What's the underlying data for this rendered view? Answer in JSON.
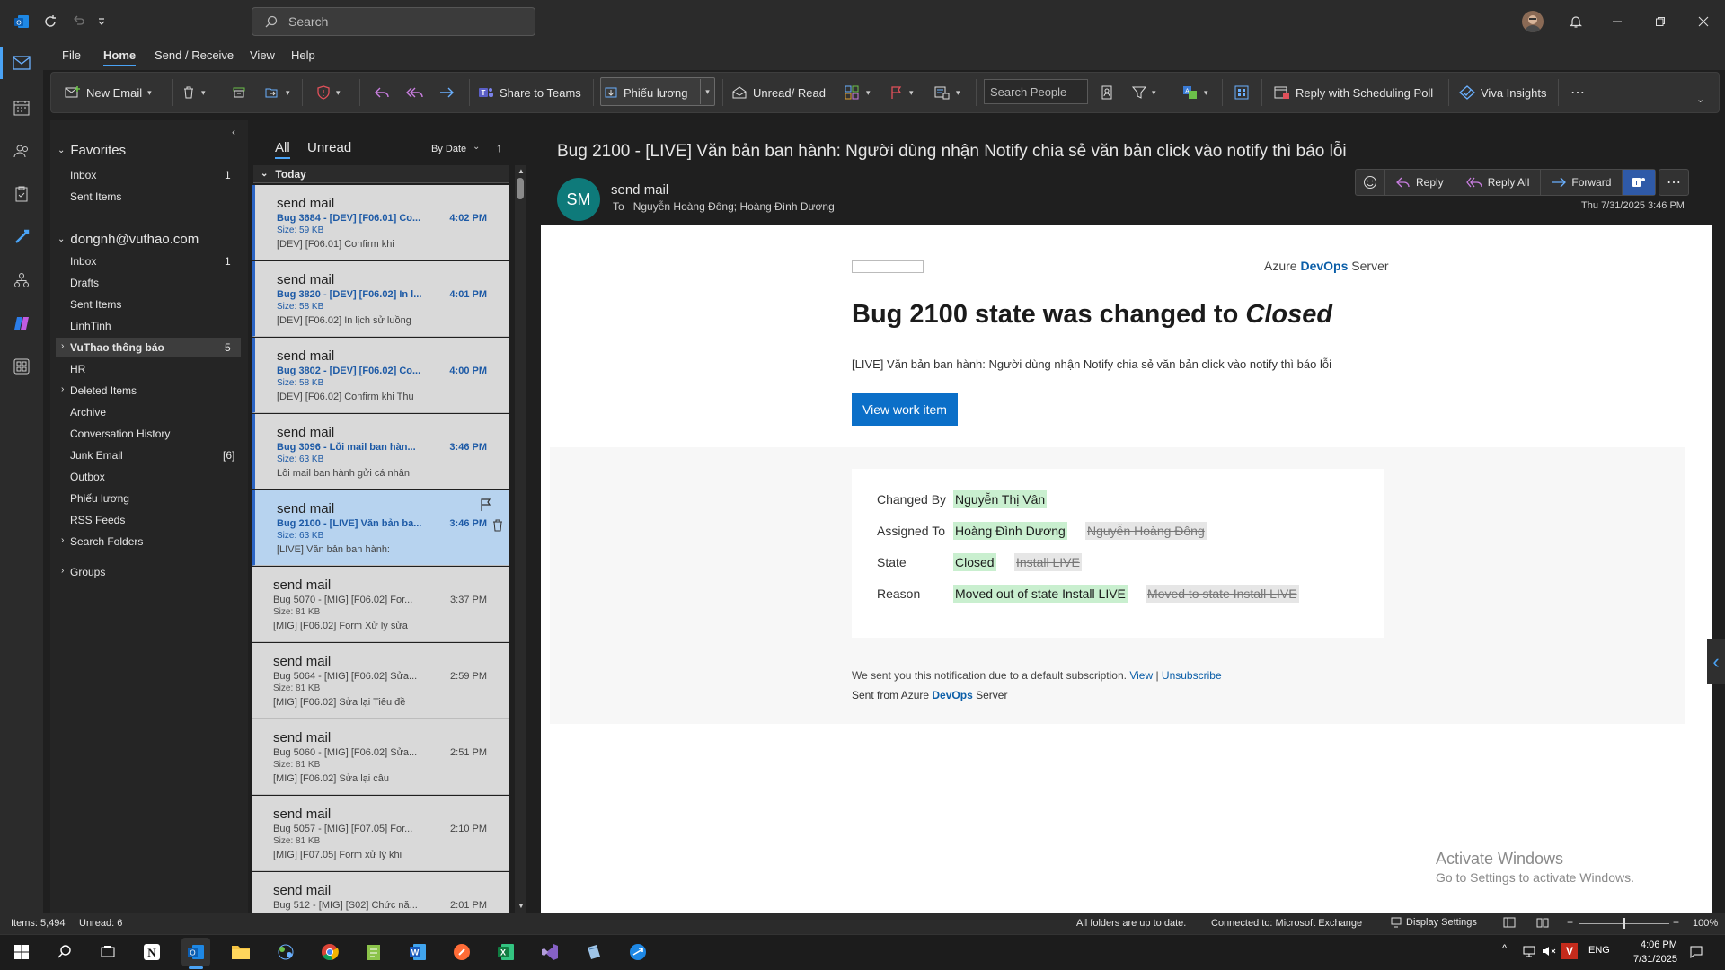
{
  "titlebar": {
    "search_placeholder": "Search"
  },
  "menu": [
    "File",
    "Home",
    "Send / Receive",
    "View",
    "Help"
  ],
  "ribbon": {
    "new_email": "New Email",
    "share_teams": "Share to Teams",
    "phieu_luong": "Phiếu lương",
    "unread_read": "Unread/ Read",
    "search_people": "Search People",
    "reply_poll": "Reply with Scheduling Poll",
    "viva": "Viva Insights"
  },
  "folders": {
    "favorites_header": "Favorites",
    "favorites": [
      {
        "label": "Inbox",
        "count": "1"
      },
      {
        "label": "Sent Items",
        "count": ""
      }
    ],
    "account": "dongnh@vuthao.com",
    "items": [
      {
        "label": "Inbox",
        "count": "1"
      },
      {
        "label": "Drafts",
        "count": ""
      },
      {
        "label": "Sent Items",
        "count": ""
      },
      {
        "label": "LinhTinh",
        "count": ""
      },
      {
        "label": "VuThao thông báo",
        "count": "5"
      },
      {
        "label": "HR",
        "count": ""
      },
      {
        "label": "Deleted Items",
        "count": ""
      },
      {
        "label": "Archive",
        "count": ""
      },
      {
        "label": "Conversation History",
        "count": ""
      },
      {
        "label": "Junk Email",
        "count": "[6]"
      },
      {
        "label": "Outbox",
        "count": ""
      },
      {
        "label": "Phiếu lương",
        "count": ""
      },
      {
        "label": "RSS Feeds",
        "count": ""
      },
      {
        "label": "Search Folders",
        "count": ""
      }
    ],
    "groups": "Groups"
  },
  "list": {
    "tab_all": "All",
    "tab_unread": "Unread",
    "sort": "By Date",
    "group_today": "Today",
    "messages": [
      {
        "sender": "send mail",
        "subject": "Bug 3684 - [DEV] [F06.01] Co...",
        "time": "4:02 PM",
        "size": "Size: 59 KB",
        "preview": "[DEV] [F06.01] Confirm khi"
      },
      {
        "sender": "send mail",
        "subject": "Bug 3820 - [DEV] [F06.02] In l...",
        "time": "4:01 PM",
        "size": "Size: 58 KB",
        "preview": "[DEV] [F06.02] In lịch sử luồng"
      },
      {
        "sender": "send mail",
        "subject": "Bug 3802 - [DEV] [F06.02] Co...",
        "time": "4:00 PM",
        "size": "Size: 58 KB",
        "preview": "[DEV] [F06.02] Confirm khi Thu"
      },
      {
        "sender": "send mail",
        "subject": "Bug 3096 - Lỗi mail ban hàn...",
        "time": "3:46 PM",
        "size": "Size: 63 KB",
        "preview": "Lỗi mail ban hành gửi cá nhân"
      },
      {
        "sender": "send mail",
        "subject": "Bug 2100 - [LIVE] Văn bản ba...",
        "time": "3:46 PM",
        "size": "Size: 63 KB",
        "preview": "[LIVE] Văn bản ban hành:"
      },
      {
        "sender": "send mail",
        "subject": "Bug 5070 - [MIG] [F06.02] For...",
        "time": "3:37 PM",
        "size": "Size: 81 KB",
        "preview": "[MIG] [F06.02] Form Xử lý sửa"
      },
      {
        "sender": "send mail",
        "subject": "Bug 5064 - [MIG] [F06.02] Sửa...",
        "time": "2:59 PM",
        "size": "Size: 81 KB",
        "preview": "[MIG] [F06.02] Sửa lại Tiêu đề"
      },
      {
        "sender": "send mail",
        "subject": "Bug 5060 - [MIG] [F06.02] Sửa...",
        "time": "2:51 PM",
        "size": "Size: 81 KB",
        "preview": "[MIG] [F06.02] Sửa lại câu"
      },
      {
        "sender": "send mail",
        "subject": "Bug 5057 - [MIG] [F07.05] For...",
        "time": "2:10 PM",
        "size": "Size: 81 KB",
        "preview": "[MIG] [F07.05] Form xử lý khi"
      },
      {
        "sender": "send mail",
        "subject": "Bug 512 - [MIG] [S02] Chức nă...",
        "time": "2:01 PM",
        "size": "",
        "preview": ""
      }
    ]
  },
  "reading": {
    "subject": "Bug 2100 - [LIVE] Văn bản ban hành: Người dùng nhận Notify chia sẻ văn bản click vào notify thì báo lỗi",
    "avatar_initials": "SM",
    "from": "send mail",
    "to_label": "To",
    "to": "Nguyễn Hoàng Đông; Hoàng Đình Dương",
    "date": "Thu 7/31/2025 3:46 PM",
    "reply": "Reply",
    "reply_all": "Reply All",
    "forward": "Forward",
    "body": {
      "brand_prefix": "Azure",
      "brand_bold": "DevOps",
      "brand_suffix": "Server",
      "title_prefix": "Bug 2100 state was changed to",
      "title_state": "Closed",
      "description": "[LIVE] Văn bản ban hành: Người dùng nhận Notify chia sẻ văn bản click vào notify thì báo lỗi",
      "view_button": "View work item",
      "fields": [
        {
          "label": "Changed By",
          "new": "Nguyễn Thị Vân",
          "old": ""
        },
        {
          "label": "Assigned To",
          "new": "Hoàng Đình Dương",
          "old": "Nguyễn Hoàng Đông"
        },
        {
          "label": "State",
          "new": "Closed",
          "old": "Install LIVE"
        },
        {
          "label": "Reason",
          "new": "Moved out of state Install LIVE",
          "old": "Moved to state Install LIVE"
        }
      ],
      "note": "We sent you this notification due to a default subscription.",
      "note_view": "View",
      "note_sep": "|",
      "note_unsub": "Unsubscribe",
      "sent_from_prefix": "Sent from Azure",
      "sent_from_bold": "DevOps",
      "sent_from_suffix": "Server"
    }
  },
  "watermark": {
    "line1": "Activate Windows",
    "line2": "Go to Settings to activate Windows."
  },
  "status": {
    "items": "Items: 5,494",
    "unread": "Unread: 6",
    "sync": "All folders are up to date.",
    "connected": "Connected to: Microsoft Exchange",
    "display": "Display Settings",
    "zoom": "100%"
  },
  "taskbar": {
    "lang": "ENG",
    "time": "4:06 PM",
    "date": "7/31/2025"
  },
  "colors": {
    "accent": "#4aa3f5",
    "unread_blue": "#1d5aa6",
    "new_value_bg": "#c9efcf",
    "button_blue": "#0b6fc8"
  }
}
